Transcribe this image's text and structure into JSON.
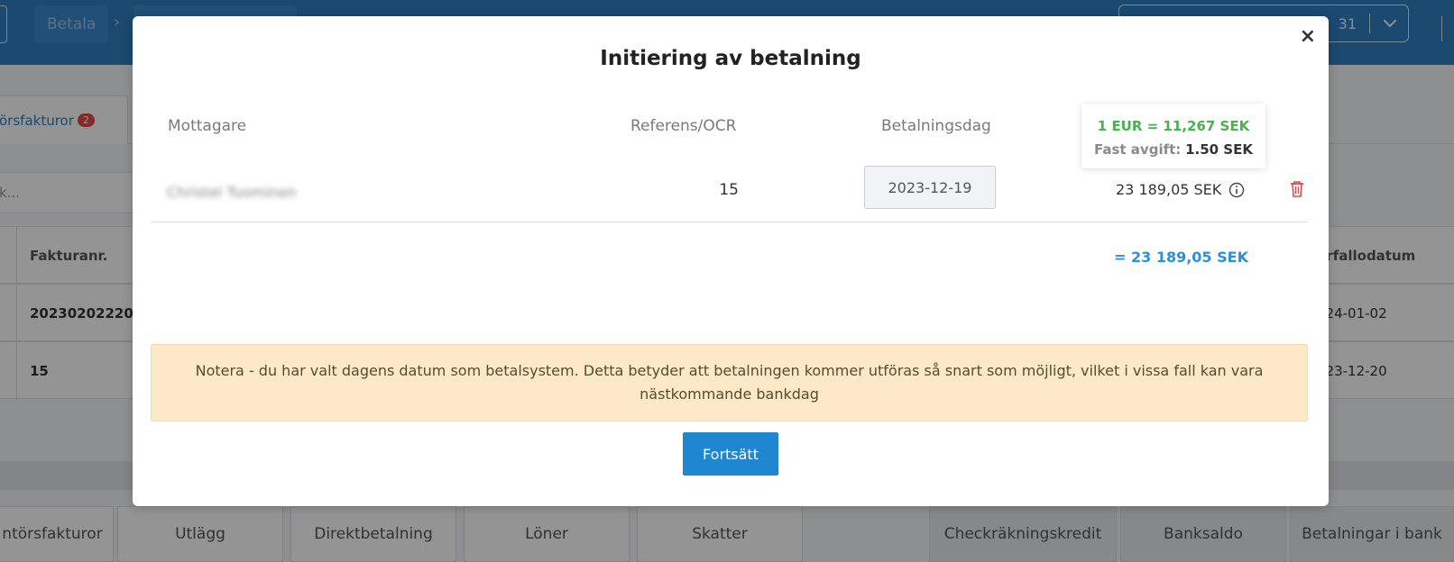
{
  "background": {
    "breadcrumb": {
      "item1": "Betala",
      "separator": "›"
    },
    "period_selector": {
      "value_fragment": "31",
      "chevron": "chevron-down-icon"
    },
    "tab_active": {
      "label": "örsfakturor",
      "badge": "2"
    },
    "search_placeholder": "k...",
    "table": {
      "headers": {
        "invoice_no": "Fakturanr.",
        "due_date": "örfallodatum"
      },
      "rows": [
        {
          "invoice_no": "20230202220",
          "due_date": "024-01-02"
        },
        {
          "invoice_no": "15",
          "due_date": "023-12-20"
        }
      ]
    },
    "bottom_tabs": [
      "ntörsfakturor",
      "Utlägg",
      "Direktbetalning",
      "Löner",
      "Skatter",
      "Checkräkningskredit",
      "Banksaldo",
      "Betalningar i bank"
    ]
  },
  "modal": {
    "close": "×",
    "title": "Initiering av betalning",
    "columns": {
      "recipient": "Mottagare",
      "reference": "Referens/OCR",
      "payment_date": "Betalningsdag"
    },
    "rate": {
      "exchange": "1 EUR = 11,267 SEK",
      "fee_label": "Fast avgift:",
      "fee_value": "1.50 SEK"
    },
    "payment": {
      "recipient": "Christel Tuominen",
      "reference": "15",
      "date": "2023-12-19",
      "amount": "23 189,05 SEK"
    },
    "total": "= 23 189,05 SEK",
    "notice": "Notera - du har valt dagens datum som betalsystem. Detta betyder att betalningen kommer utföras så snart som möjligt, vilket i vissa fall kan vara nästkommande bankdag",
    "continue_button": "Fortsätt"
  },
  "colors": {
    "primary": "#1f87d2",
    "topbar": "#2f7fc1",
    "rate_green": "#4caf50",
    "total_blue": "#2f8fd8",
    "delete_red": "#e04b4b",
    "notice_bg": "#fde8c8"
  }
}
